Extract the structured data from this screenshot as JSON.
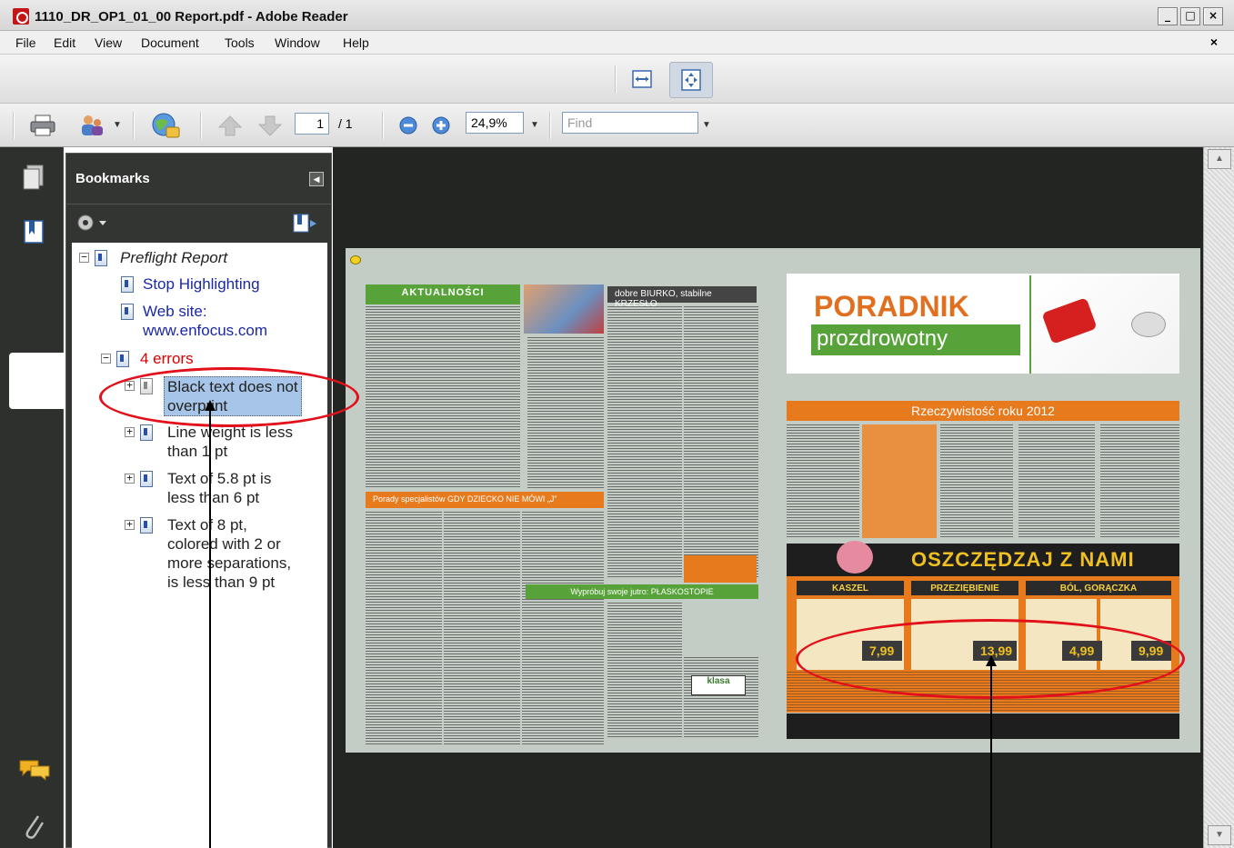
{
  "window": {
    "title": "1110_DR_OP1_01_00 Report.pdf - Adobe Reader",
    "controls": [
      "_",
      "□",
      "×"
    ]
  },
  "menu": {
    "items": [
      "File",
      "Edit",
      "View",
      "Document",
      "Tools",
      "Window",
      "Help"
    ],
    "close": "×"
  },
  "toolbar": {
    "page_current": "1",
    "page_total": "/ 1",
    "zoom": "24,9%",
    "find_placeholder": "Find"
  },
  "bookmarks": {
    "title": "Bookmarks",
    "tree": {
      "root": "Preflight Report",
      "stop_highlighting": "Stop Highlighting",
      "website_line1": "Web site:",
      "website_line2": "www.enfocus.com",
      "errors": "4 errors",
      "err1_line1": "Black text does not",
      "err1_line2": "overprint",
      "err2_line1": "Line weight is less",
      "err2_line2": "than 1 pt",
      "err3_line1": "Text of 5.8 pt is",
      "err3_line2": "less than 6 pt",
      "err4_line1": "Text of 8 pt,",
      "err4_line2": "colored with 2 or",
      "err4_line3": "more separations,",
      "err4_line4": "is less than 9 pt"
    }
  },
  "document": {
    "left_headers": {
      "aktualnosci": "AKTUALNOŚCI",
      "biurko": "dobre BIURKO, stabilne KRZESŁO",
      "porady": "Porady specjalistów GDY DZIECKO NIE MÓWI „J”",
      "plaskostopie": "Wypróbuj swoje jutro: PŁASKOSTOPIE"
    },
    "right_page": {
      "poradnik": "PORADNIK",
      "prozdrowotny": "prozdrowotny",
      "rzeczywistosc": "Rzeczywistość roku 2012",
      "oszczedzaj": "OSZCZĘDZAJ Z NAMI",
      "categories": [
        "KASZEL",
        "PRZEZIĘBIENIE",
        "BÓL, GORĄCZKA"
      ],
      "prices": [
        "7,99",
        "13,99",
        "4,99",
        "9,99"
      ]
    }
  },
  "colors": {
    "doc_bg": "#222522",
    "page_bg": "#c3ccc5",
    "green_header": "#57a33a",
    "orange": "#e87a1e",
    "annotation_red": "#e2101a"
  }
}
